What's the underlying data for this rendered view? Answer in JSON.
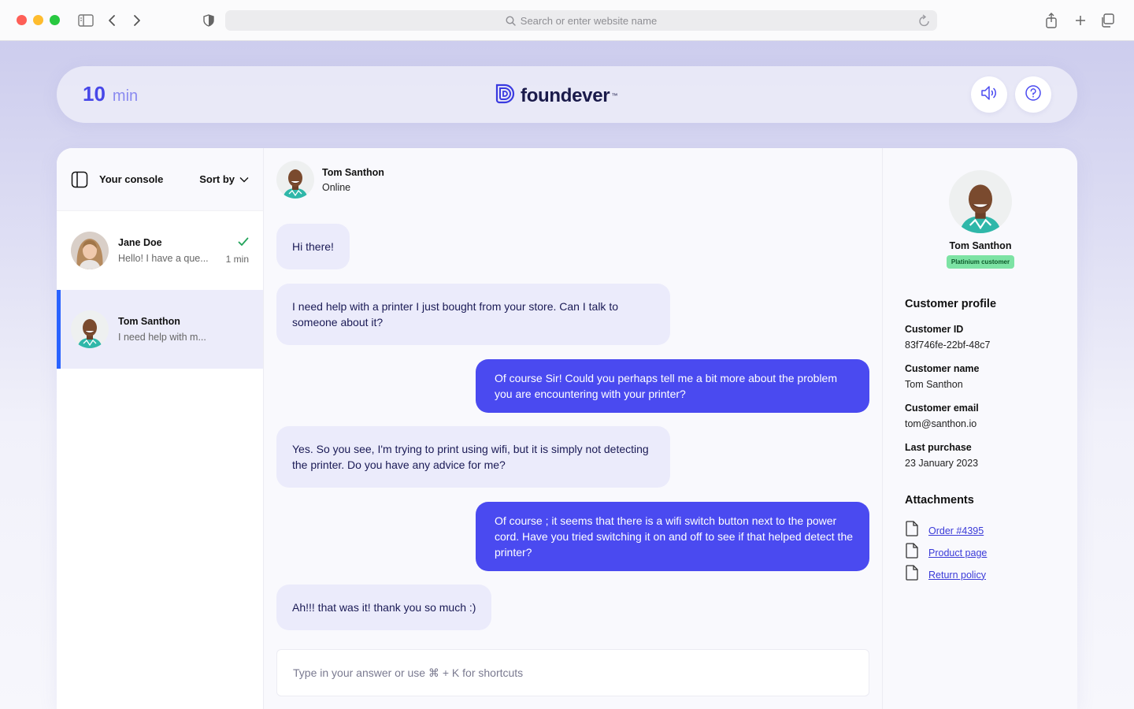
{
  "browser": {
    "url_placeholder": "Search or enter website name"
  },
  "header": {
    "timer_value": "10",
    "timer_unit": "min",
    "brand": "foundever",
    "brand_tm": "™"
  },
  "console": {
    "title": "Your console",
    "sort_label": "Sort by",
    "conversations": [
      {
        "name": "Jane Doe",
        "preview": "Hello! I have a que...",
        "time": "1 min",
        "read": true
      },
      {
        "name": "Tom Santhon",
        "preview": "I need help with m..."
      }
    ]
  },
  "chat": {
    "contact_name": "Tom Santhon",
    "contact_status": "Online",
    "messages": [
      {
        "dir": "in",
        "text": "Hi there!"
      },
      {
        "dir": "in",
        "text": "I need help with a printer I just bought from your store. Can I talk to someone about it?"
      },
      {
        "dir": "out",
        "text": "Of course Sir! Could you perhaps tell me a bit more about the problem you are encountering with your printer?"
      },
      {
        "dir": "in",
        "text": "Yes. So you see, I'm trying to print using wifi, but it is simply not detecting the printer. Do you have any advice for me?"
      },
      {
        "dir": "out",
        "text": "Of course ; it seems that there is a wifi switch button next to the power cord. Have you tried switching it on and off to see if that helped detect the printer?"
      },
      {
        "dir": "in",
        "text": "Ah!!! that was it! thank you so much :)"
      }
    ],
    "composer_placeholder": "Type in your answer or use ⌘ + K for shortcuts"
  },
  "profile": {
    "name": "Tom Santhon",
    "badge": "Platinium customer",
    "section_title": "Customer profile",
    "fields": [
      {
        "label": "Customer ID",
        "value": "83f746fe-22bf-48c7"
      },
      {
        "label": "Customer name",
        "value": "Tom Santhon"
      },
      {
        "label": "Customer email",
        "value": "tom@santhon.io"
      },
      {
        "label": "Last purchase",
        "value": "23 January 2023"
      }
    ],
    "attachments_title": "Attachments",
    "attachments": [
      "Order #4395",
      "Product page",
      "Return policy"
    ]
  },
  "colors": {
    "accent": "#4a4af0",
    "active_bar": "#2962ff",
    "badge_bg": "#7de3a4"
  }
}
